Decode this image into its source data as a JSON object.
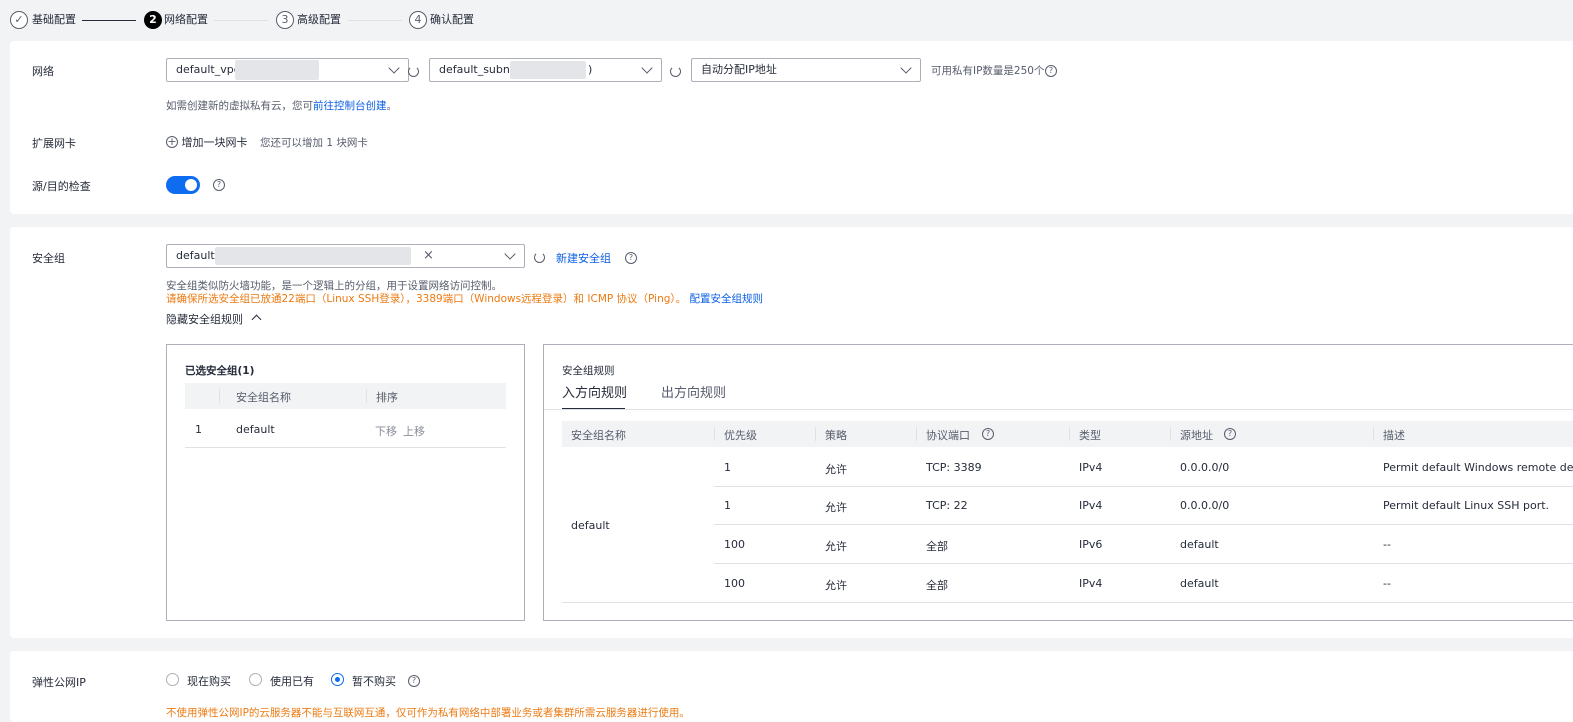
{
  "stepper": {
    "steps": [
      {
        "num": "✓",
        "label": "基础配置"
      },
      {
        "num": "2",
        "label": "网络配置"
      },
      {
        "num": "3",
        "label": "高级配置"
      },
      {
        "num": "4",
        "label": "确认配置"
      }
    ]
  },
  "network": {
    "label": "网络",
    "vpc_value": "default_vpc",
    "subnet_value": "default_subnet(",
    "subnet_suffix": ")",
    "ip_value": "自动分配IP地址",
    "available_ip": "可用私有IP数量是250个",
    "hint_prefix": "如需创建新的虚拟私有云，您可",
    "hint_link": "前往控制台创建",
    "hint_suffix": "。"
  },
  "nic": {
    "label": "扩展网卡",
    "add_label": "增加一块网卡",
    "add_hint": "您还可以增加 1 块网卡"
  },
  "src_dst": {
    "label": "源/目的检查"
  },
  "security_group": {
    "label": "安全组",
    "select_value": "default(",
    "new_link": "新建安全组",
    "hint": "安全组类似防火墙功能，是一个逻辑上的分组，用于设置网络访问控制。",
    "warn_text": "请确保所选安全组已放通22端口（Linux SSH登录），3389端口（Windows远程登录）和 ICMP 协议（Ping）。",
    "warn_link": "配置安全组规则",
    "toggle_rules": "隐藏安全组规则"
  },
  "selected_groups": {
    "title": "已选安全组(1)",
    "columns": [
      "安全组名称",
      "排序"
    ],
    "rows": [
      {
        "index": "1",
        "name": "default",
        "down": "下移",
        "up": "上移"
      }
    ]
  },
  "rules": {
    "title": "安全组规则",
    "tabs": [
      "入方向规则",
      "出方向规则"
    ],
    "columns": [
      "安全组名称",
      "优先级",
      "策略",
      "协议端口",
      "类型",
      "源地址",
      "描述"
    ],
    "group_name": "default",
    "rows": [
      {
        "priority": "1",
        "policy": "允许",
        "port": "TCP: 3389",
        "type": "IPv4",
        "source": "0.0.0.0/0",
        "desc": "Permit default Windows remote des..."
      },
      {
        "priority": "1",
        "policy": "允许",
        "port": "TCP: 22",
        "type": "IPv4",
        "source": "0.0.0.0/0",
        "desc": "Permit default Linux SSH port."
      },
      {
        "priority": "100",
        "policy": "允许",
        "port": "全部",
        "type": "IPv6",
        "source": "default",
        "desc": "--"
      },
      {
        "priority": "100",
        "policy": "允许",
        "port": "全部",
        "type": "IPv4",
        "source": "default",
        "desc": "--"
      }
    ]
  },
  "eip": {
    "label": "弹性公网IP",
    "options": [
      "现在购买",
      "使用已有",
      "暂不购买"
    ],
    "selected": "暂不购买",
    "warn": "不使用弹性公网IP的云服务器不能与互联网互通，仅可作为私有网络中部署业务或者集群所需云服务器进行使用。"
  },
  "colors": {
    "primary": "#0d6cf0",
    "link": "#0a5fe5",
    "warning": "#ed7a12"
  }
}
